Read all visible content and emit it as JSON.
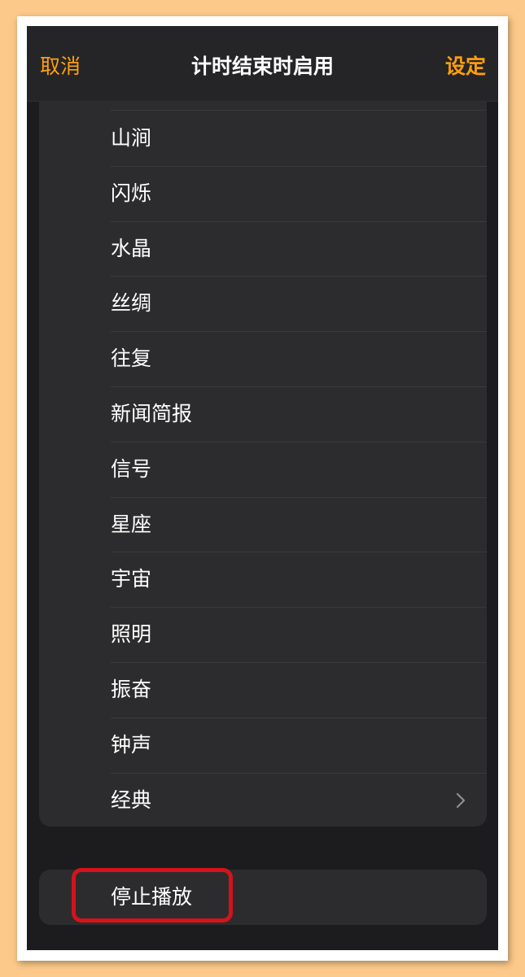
{
  "nav": {
    "cancel_label": "取消",
    "title": "计时结束时启用",
    "set_label": "设定"
  },
  "sounds": [
    {
      "label": "山涧"
    },
    {
      "label": "闪烁"
    },
    {
      "label": "水晶"
    },
    {
      "label": "丝绸"
    },
    {
      "label": "往复"
    },
    {
      "label": "新闻简报"
    },
    {
      "label": "信号"
    },
    {
      "label": "星座"
    },
    {
      "label": "宇宙"
    },
    {
      "label": "照明"
    },
    {
      "label": "振奋"
    },
    {
      "label": "钟声"
    },
    {
      "label": "经典"
    }
  ],
  "stop": {
    "label": "停止播放"
  },
  "colors": {
    "accent": "#ff9f0a",
    "background": "#1c1c1e",
    "card": "#2c2c2e",
    "highlight": "#d4131a",
    "page_background": "#fdc98a"
  },
  "icons": {
    "classic_chevron": "chevron-right-icon"
  }
}
